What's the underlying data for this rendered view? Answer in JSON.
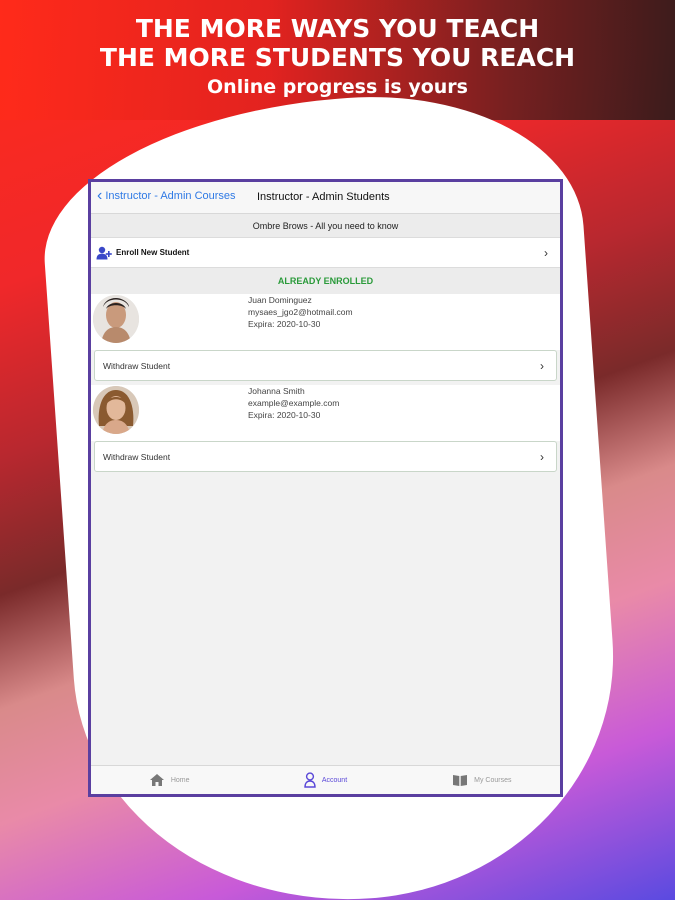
{
  "promo": {
    "line1": "THE MORE WAYS YOU TEACH",
    "line2": "THE MORE STUDENTS YOU REACH",
    "line3": "Online progress is yours"
  },
  "navbar": {
    "back_label": "Instructor - Admin Courses",
    "title": "Instructor - Admin Students"
  },
  "course": {
    "title": "Ombre Brows - All you need to know"
  },
  "enroll": {
    "label": "Enroll New Student"
  },
  "section": {
    "heading": "ALREADY ENROLLED"
  },
  "students": [
    {
      "name": "Juan Dominguez",
      "email": "mysaes_jgo2@hotmail.com",
      "expiry": "Expira: 2020-10-30",
      "action": "Withdraw Student"
    },
    {
      "name": "Johanna Smith",
      "email": "example@example.com",
      "expiry": "Expira: 2020-10-30",
      "action": "Withdraw Student"
    }
  ],
  "tabs": [
    {
      "label": "Home",
      "icon": "home-icon"
    },
    {
      "label": "Account",
      "icon": "person-icon",
      "active": true
    },
    {
      "label": "My Courses",
      "icon": "book-icon"
    }
  ],
  "colors": {
    "accent": "#2f7ae5",
    "enrolled": "#2a9a3a",
    "active_tab": "#5a48d8",
    "frame": "#5a3fa0"
  }
}
